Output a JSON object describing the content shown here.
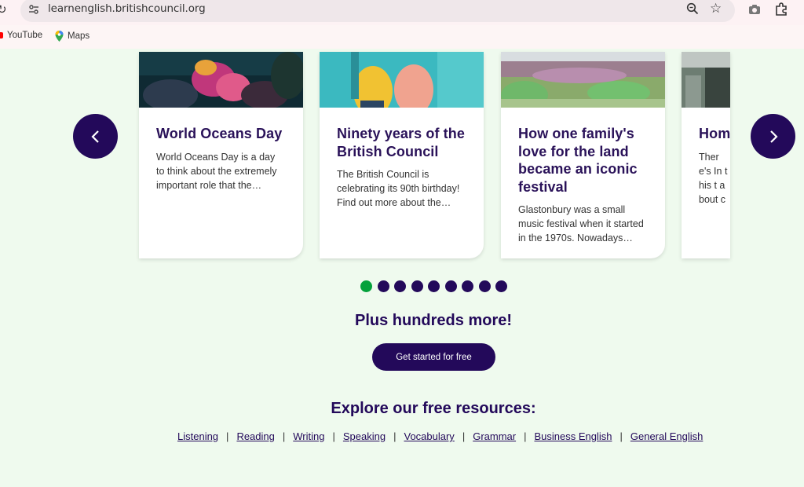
{
  "browser": {
    "url": "learnenglish.britishcouncil.org",
    "bookmarks": [
      {
        "label": "YouTube",
        "icon": "youtube-icon"
      },
      {
        "label": "Maps",
        "icon": "maps-pin-icon"
      }
    ]
  },
  "carousel": {
    "cards": [
      {
        "title": "World Oceans Day",
        "text": "World Oceans Day is a day to think about the extremely important role that the…"
      },
      {
        "title": "Ninety years of the British Council",
        "text": "The British Council is celebrating its 90th birthday! Find out more about the…"
      },
      {
        "title": "How one family's love for the land became an iconic festival",
        "text": "Glastonbury was a small music festival when it started in the 1970s. Nowadays…"
      },
      {
        "title": "Hom",
        "text": "There's In this t about c"
      }
    ],
    "prev_icon": "chevron-left-icon",
    "next_icon": "chevron-right-icon",
    "active_page": 1,
    "page_count": 9
  },
  "promo": {
    "headline": "Plus hundreds more!",
    "cta_label": "Get started for free"
  },
  "resources": {
    "heading": "Explore our free resources:",
    "links": [
      "Listening",
      "Reading",
      "Writing",
      "Speaking",
      "Vocabulary",
      "Grammar",
      "Business English",
      "General English"
    ]
  },
  "colors": {
    "brand": "#23095a",
    "active_dot": "#04a13b",
    "page_bg": "#effaee"
  }
}
